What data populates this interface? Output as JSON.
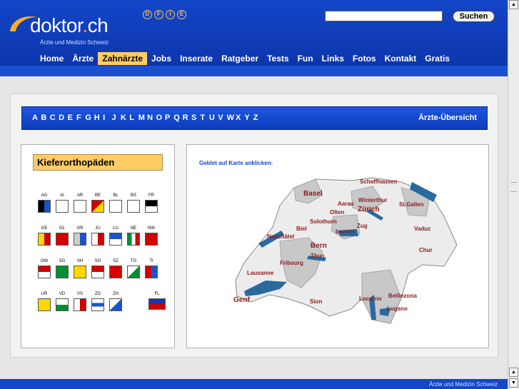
{
  "logo": {
    "main": "doktor",
    "dot": ".",
    "tld": "ch",
    "subtitle": "Ärzte und Medizin Schweiz"
  },
  "languages": [
    "D",
    "F",
    "I",
    "E"
  ],
  "search": {
    "placeholder": "",
    "button": "Suchen"
  },
  "nav": [
    "Home",
    "Ärzte",
    "Zahnärzte",
    "Jobs",
    "Inserate",
    "Ratgeber",
    "Tests",
    "Fun",
    "Links",
    "Fotos",
    "Kontakt",
    "Gratis"
  ],
  "nav_active": "Zahnärzte",
  "alphabet": [
    "A",
    "B",
    "C",
    "D",
    "E",
    "F",
    "G",
    "H",
    "I",
    "J",
    "K",
    "L",
    "M",
    "N",
    "O",
    "P",
    "Q",
    "R",
    "S",
    "T",
    "U",
    "V",
    "W",
    "X",
    "Y",
    "Z"
  ],
  "overview_link": "Ärzte-Übersicht",
  "left": {
    "title": "Kieferorthopäden"
  },
  "cantons": [
    [
      "AG",
      "AI",
      "AR",
      "BE",
      "BL",
      "BS",
      "FR"
    ],
    [
      "GE",
      "GL",
      "GR",
      "JU",
      "LU",
      "NE",
      "NW"
    ],
    [
      "OW",
      "SG",
      "SH",
      "SO",
      "SZ",
      "TG",
      "TI"
    ],
    [
      "UR",
      "VD",
      "VS",
      "ZG",
      "ZH",
      "",
      "FL"
    ]
  ],
  "map": {
    "caption": "Geblet auf Karte anklicken:",
    "cities": [
      "Schaffhausen",
      "Basel",
      "Winterthur",
      "Aarau",
      "Zürich",
      "St.Gallen",
      "Olten",
      "Solothurn",
      "Zug",
      "Biel",
      "Luzern",
      "Vaduz",
      "Neuchâtel",
      "Bern",
      "Chur",
      "Thun",
      "Fribourg",
      "Lausanne",
      "Genf",
      "Sion",
      "Locarno",
      "Bellinzona",
      "Lugano"
    ]
  },
  "footer": "Ärzte und Medizin Schweiz",
  "colors": {
    "header_blue": "#1446c8",
    "accent_orange": "#ffcc66",
    "city_red": "#8b1a1a",
    "lake_blue": "#2a6a9e"
  }
}
